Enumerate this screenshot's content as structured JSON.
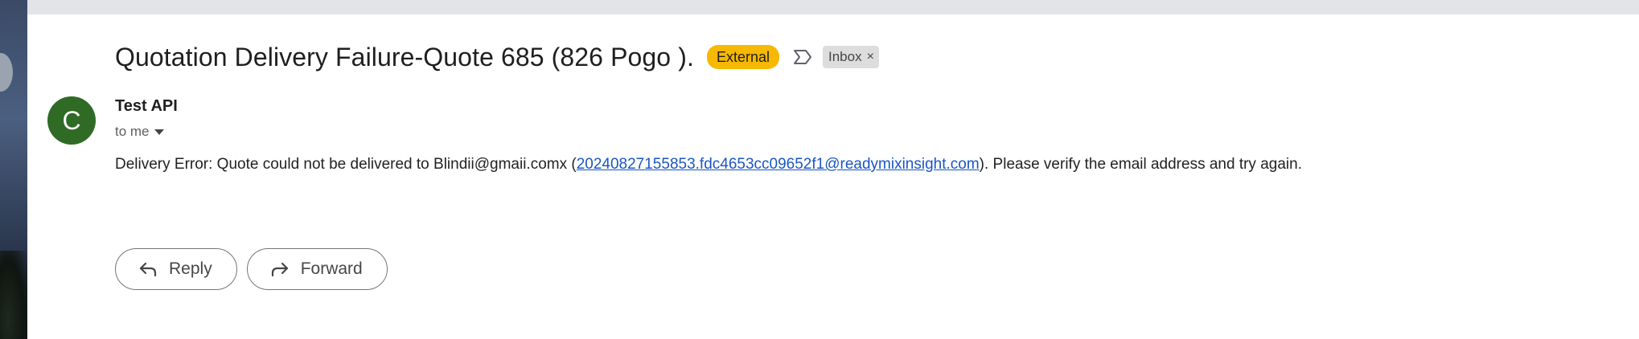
{
  "email": {
    "subject": "Quotation Delivery Failure-Quote 685 (826 Pogo ).",
    "labels": {
      "external": "External",
      "inbox": "Inbox",
      "inbox_close": "×"
    },
    "sender": {
      "avatar_letter": "C",
      "name": "Test API",
      "recipient_text": "to me"
    },
    "body": {
      "prefix": "Delivery Error: Quote could not be delivered to Blindii@gmaii.comx (",
      "link": "20240827155853.fdc4653cc09652f1@readymixinsight.com",
      "suffix": "). Please verify the email address and try again."
    }
  },
  "actions": {
    "reply_label": "Reply",
    "forward_label": "Forward"
  },
  "colors": {
    "external_badge": "#f6b800",
    "avatar": "#2f6b25",
    "link": "#1a56c4",
    "inbox_badge": "#dddddd"
  },
  "icons": {
    "important": "important-marker-icon",
    "recipient_dropdown": "chevron-down-icon",
    "reply": "reply-arrow-icon",
    "forward": "forward-arrow-icon"
  }
}
